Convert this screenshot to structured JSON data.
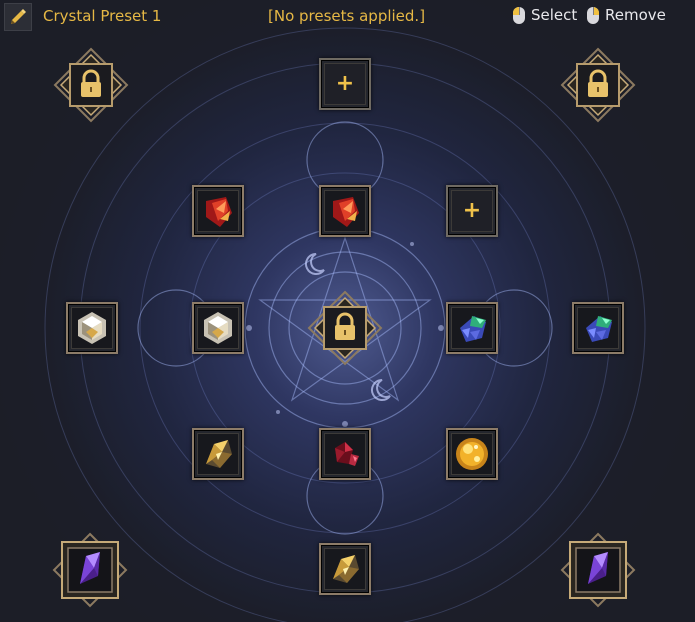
{
  "header": {
    "preset_name": "Crystal Preset 1",
    "status": "[No presets applied.]",
    "select_label": "Select",
    "remove_label": "Remove",
    "edit_icon": "pencil-icon"
  },
  "colors": {
    "accent_gold": "#e6b845",
    "background": "#1c1e27",
    "glow": "#7a8ce6"
  },
  "slots": [
    {
      "name": "slot-locked-top-left",
      "state": "locked",
      "icon": "lock-icon"
    },
    {
      "name": "slot-empty-top-center",
      "state": "empty",
      "icon": "plus-icon"
    },
    {
      "name": "slot-locked-top-right",
      "state": "locked",
      "icon": "lock-icon"
    },
    {
      "name": "slot-red-crystal-1",
      "state": "filled",
      "icon": "red-crystal-icon"
    },
    {
      "name": "slot-red-crystal-2",
      "state": "filled",
      "icon": "red-crystal-icon"
    },
    {
      "name": "slot-empty-inner-right",
      "state": "empty",
      "icon": "plus-icon"
    },
    {
      "name": "slot-white-crystal-1",
      "state": "filled",
      "icon": "white-crystal-icon"
    },
    {
      "name": "slot-white-crystal-2",
      "state": "filled",
      "icon": "white-crystal-icon"
    },
    {
      "name": "slot-locked-center",
      "state": "locked",
      "icon": "lock-icon"
    },
    {
      "name": "slot-green-crystal-1",
      "state": "filled",
      "icon": "green-blue-crystal-icon"
    },
    {
      "name": "slot-green-crystal-2",
      "state": "filled",
      "icon": "green-blue-crystal-icon"
    },
    {
      "name": "slot-gold-shard-1",
      "state": "filled",
      "icon": "gold-shard-icon"
    },
    {
      "name": "slot-dark-red-crystal",
      "state": "filled",
      "icon": "dark-red-crystal-icon"
    },
    {
      "name": "slot-gold-orb",
      "state": "filled",
      "icon": "gold-orb-icon"
    },
    {
      "name": "slot-purple-crystal-left",
      "state": "filled",
      "icon": "purple-crystal-icon"
    },
    {
      "name": "slot-gold-shard-2",
      "state": "filled",
      "icon": "gold-shard-icon"
    },
    {
      "name": "slot-purple-crystal-right",
      "state": "filled",
      "icon": "purple-crystal-icon"
    }
  ]
}
